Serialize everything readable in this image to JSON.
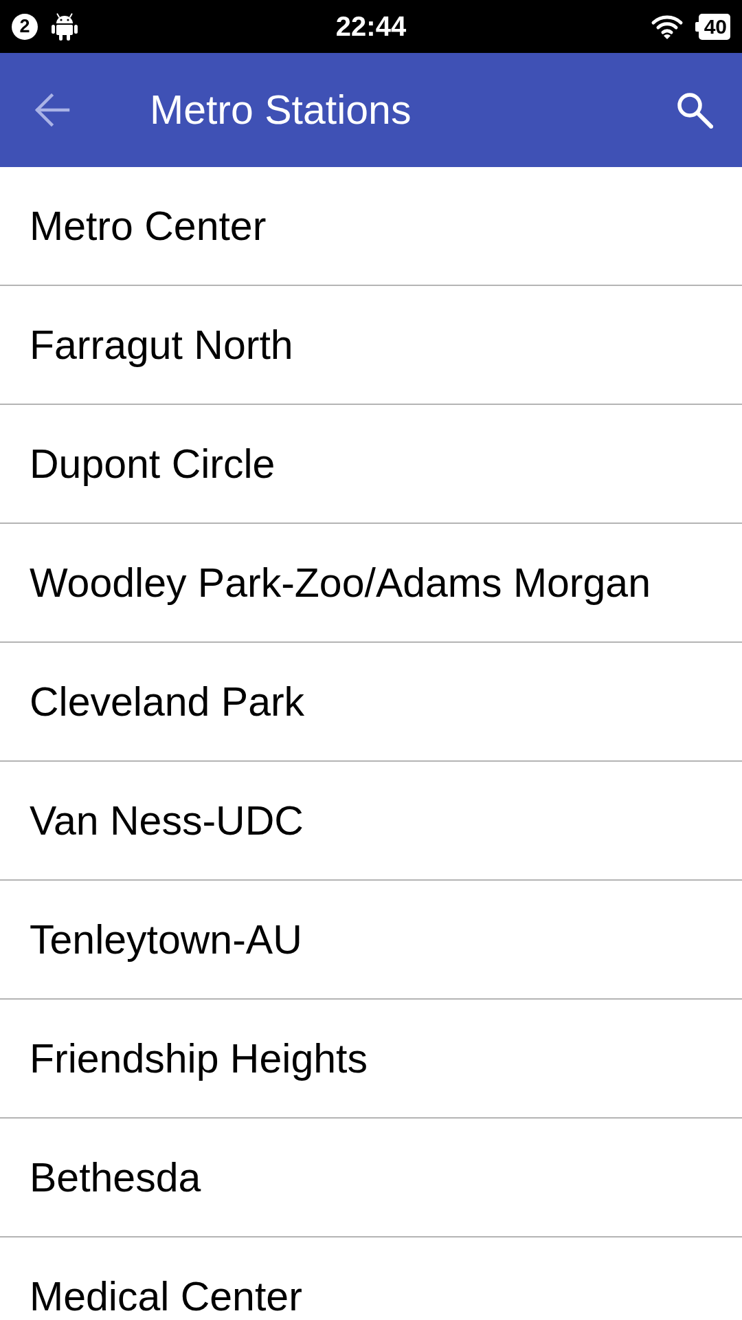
{
  "status_bar": {
    "notification_count": "2",
    "time": "22:44",
    "battery": "40"
  },
  "app_bar": {
    "title": "Metro Stations"
  },
  "stations": [
    "Metro Center",
    "Farragut North",
    "Dupont Circle",
    "Woodley Park-Zoo/Adams Morgan",
    "Cleveland Park",
    "Van Ness-UDC",
    "Tenleytown-AU",
    "Friendship Heights",
    "Bethesda",
    "Medical Center"
  ]
}
